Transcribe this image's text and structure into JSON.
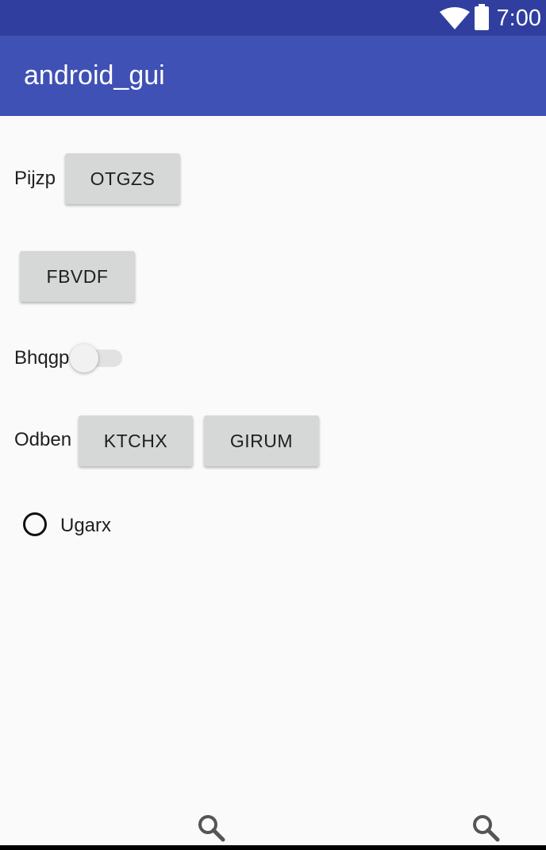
{
  "status_bar": {
    "time": "7:00",
    "wifi_icon": "wifi-icon",
    "battery_icon": "battery-icon"
  },
  "app_bar": {
    "title": "android_gui"
  },
  "rows": {
    "row1": {
      "label": "Pijzp",
      "button": "OTGZS"
    },
    "row2": {
      "button": "FBVDF"
    },
    "row3": {
      "label": "Bhqgp",
      "switch_on": false
    },
    "row4": {
      "label": "Odben",
      "button1": "KTCHX",
      "button2": "GIRUM"
    },
    "row5": {
      "radio_label": "Ugarx",
      "radio_checked": false
    }
  },
  "nav": {
    "icons": [
      "search-icon",
      "search-icon"
    ]
  }
}
